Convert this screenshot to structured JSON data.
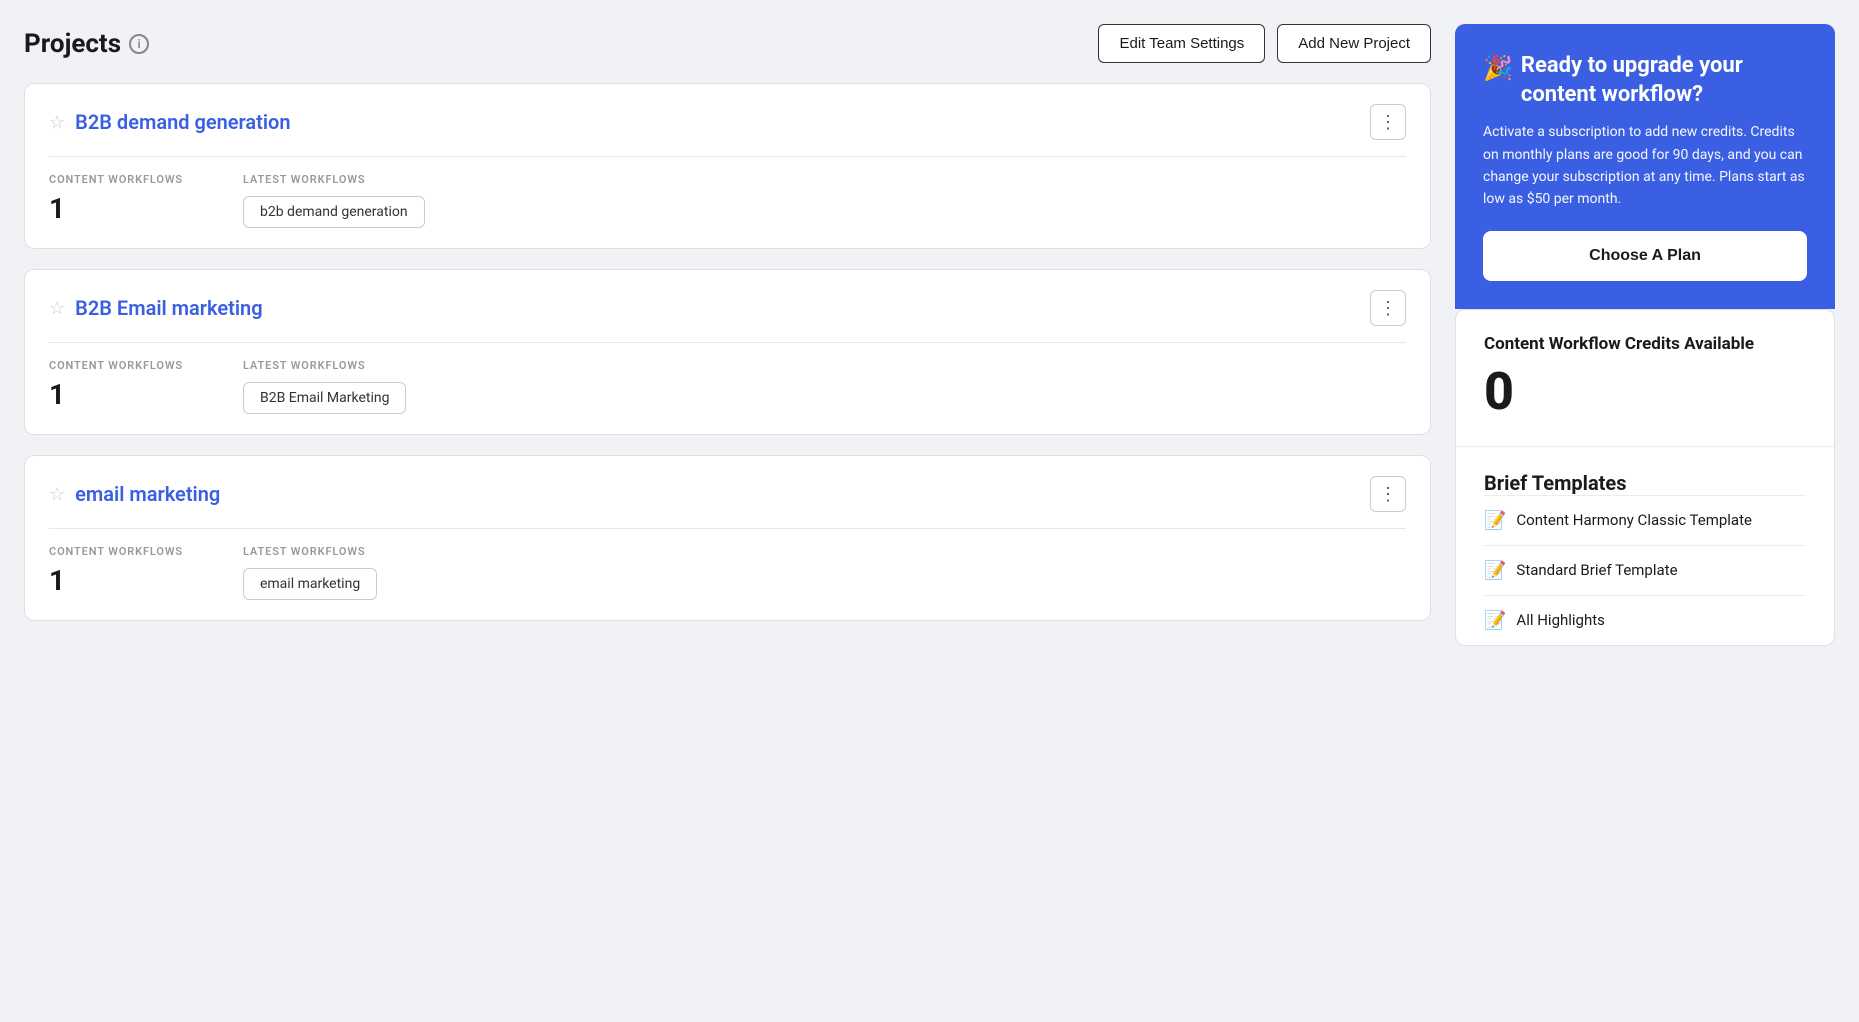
{
  "page": {
    "title": "Projects",
    "info_icon_label": "i"
  },
  "header": {
    "edit_team_settings_label": "Edit Team Settings",
    "add_new_project_label": "Add New Project"
  },
  "projects": [
    {
      "id": 1,
      "name": "B2B demand generation",
      "content_workflows_label": "CONTENT WORKFLOWS",
      "content_workflows_count": "1",
      "latest_workflows_label": "LATEST WORKFLOWS",
      "latest_workflow_tag": "b2b demand generation"
    },
    {
      "id": 2,
      "name": "B2B Email marketing",
      "content_workflows_label": "CONTENT WORKFLOWS",
      "content_workflows_count": "1",
      "latest_workflows_label": "LATEST WORKFLOWS",
      "latest_workflow_tag": "B2B Email Marketing"
    },
    {
      "id": 3,
      "name": "email marketing",
      "content_workflows_label": "CONTENT WORKFLOWS",
      "content_workflows_count": "1",
      "latest_workflows_label": "LATEST WORKFLOWS",
      "latest_workflow_tag": "email marketing"
    }
  ],
  "upgrade_banner": {
    "emoji": "🎉",
    "title": "Ready to upgrade your content workflow?",
    "description": "Activate a subscription to add new credits. Credits on monthly plans are good for 90 days, and you can change your subscription at any time. Plans start as low as $50 per month.",
    "cta_label": "Choose A Plan"
  },
  "credits": {
    "title": "Content Workflow Credits Available",
    "value": "0"
  },
  "brief_templates": {
    "title": "Brief Templates",
    "items": [
      {
        "emoji": "📝",
        "name": "Content Harmony Classic Template"
      },
      {
        "emoji": "📝",
        "name": "Standard Brief Template"
      },
      {
        "emoji": "📝",
        "name": "All Highlights"
      }
    ]
  }
}
